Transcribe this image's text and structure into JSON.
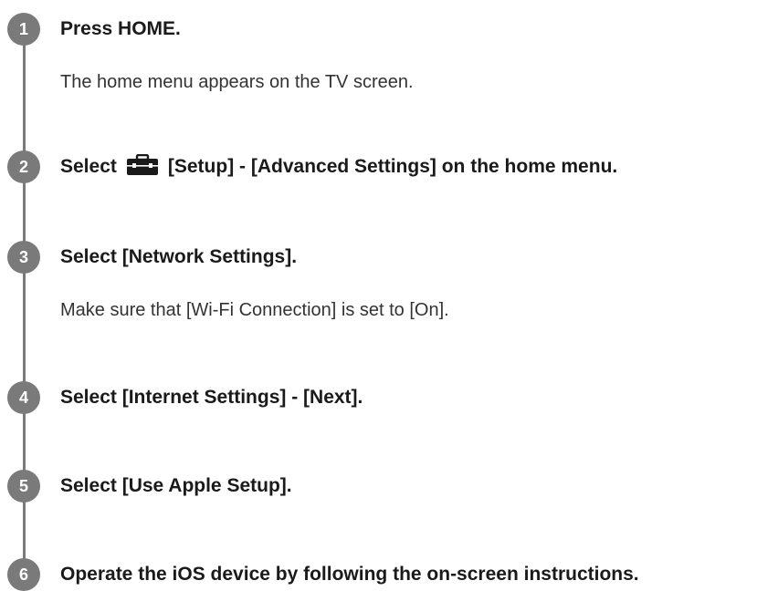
{
  "steps": [
    {
      "number": "1",
      "title": "Press HOME.",
      "description": "The home menu appears on the TV screen."
    },
    {
      "number": "2",
      "title_prefix": "Select",
      "title_icon": "toolbox-icon",
      "title_suffix": "[Setup] - [Advanced Settings] on the home menu."
    },
    {
      "number": "3",
      "title": "Select [Network Settings].",
      "description": "Make sure that [Wi-Fi Connection] is set to [On]."
    },
    {
      "number": "4",
      "title": "Select [Internet Settings] - [Next]."
    },
    {
      "number": "5",
      "title": "Select [Use Apple Setup]."
    },
    {
      "number": "6",
      "title": "Operate the iOS device by following the on-screen instructions."
    }
  ],
  "colors": {
    "step_circle": "#7a7a7a",
    "text": "#1a1a1a"
  }
}
